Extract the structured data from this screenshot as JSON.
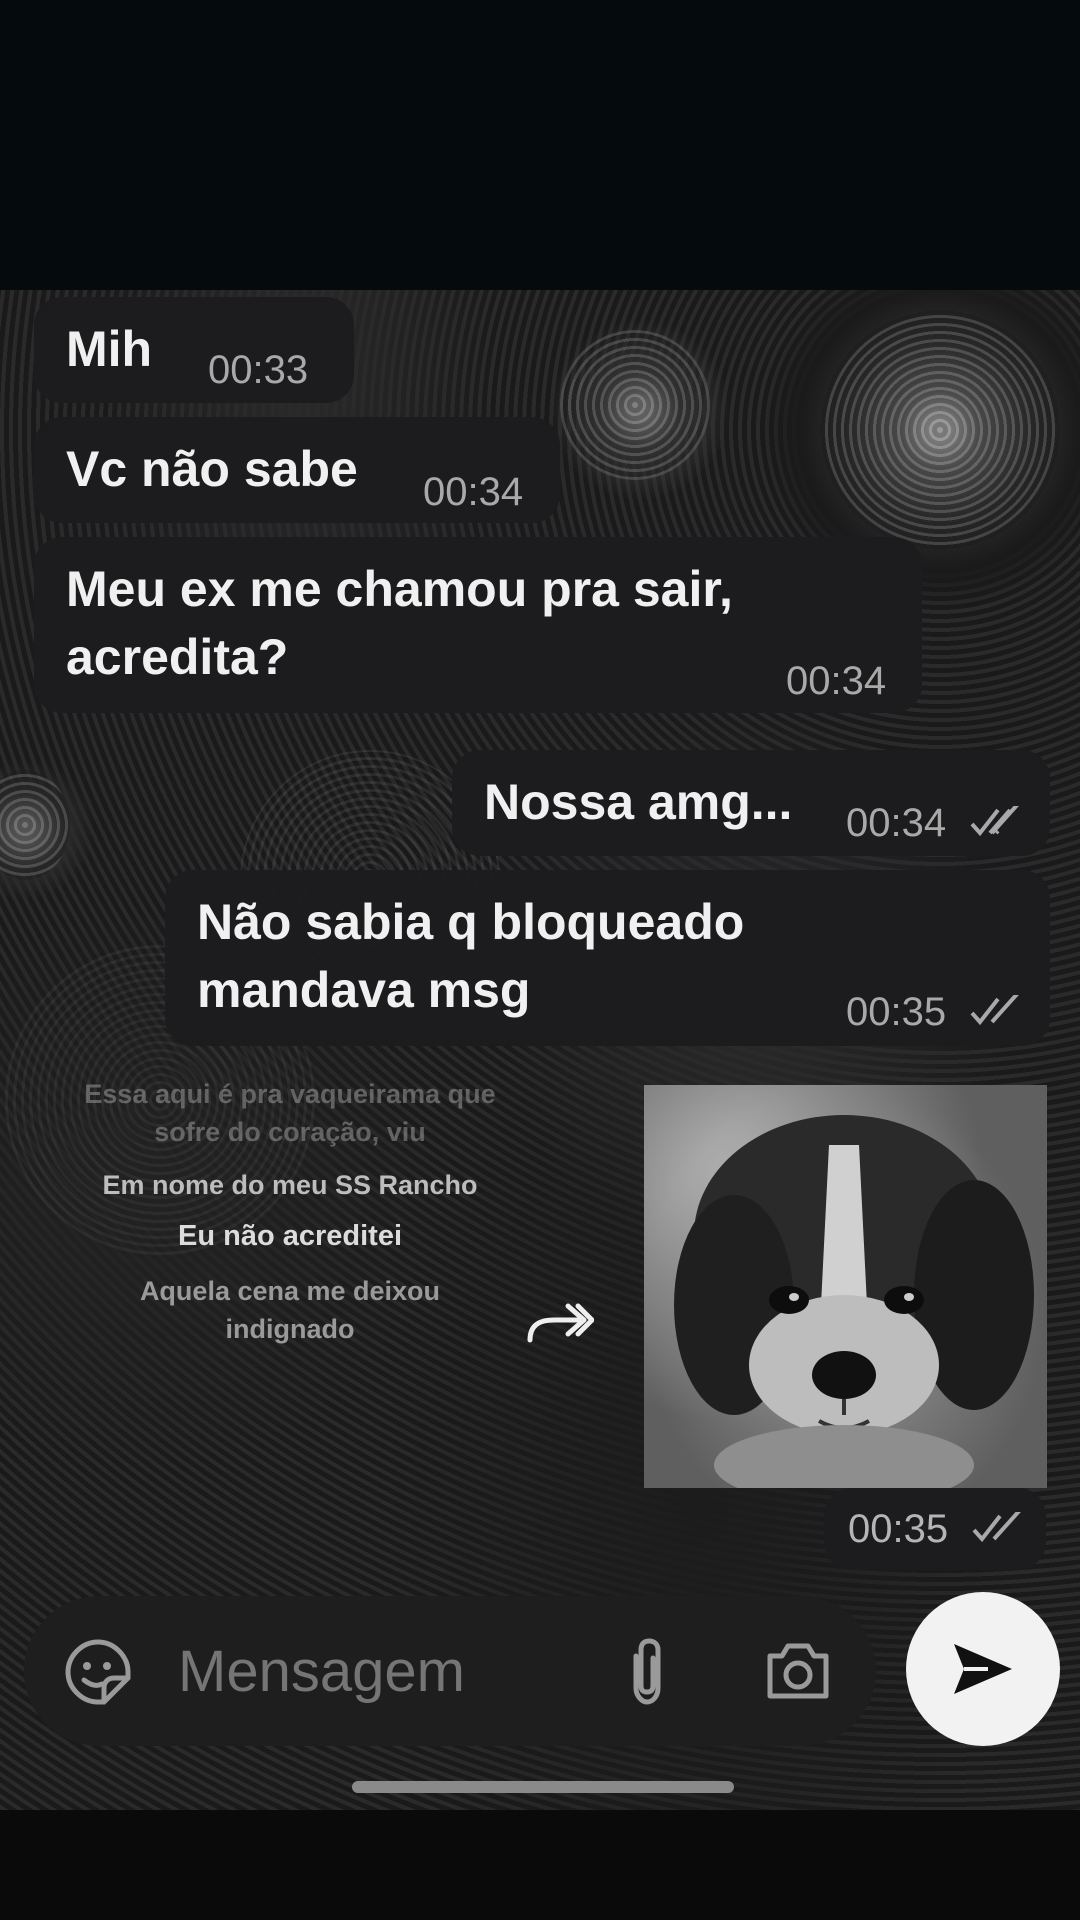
{
  "messages": [
    {
      "text": "Mih",
      "time": "00:33",
      "direction": "incoming"
    },
    {
      "text": "Vc não sabe",
      "time": "00:34",
      "direction": "incoming"
    },
    {
      "text_line1": "Meu ex me chamou pra sair,",
      "text_line2": "acredita?",
      "time": "00:34",
      "direction": "incoming"
    },
    {
      "text": "Nossa amg...",
      "time": "00:34",
      "direction": "outgoing",
      "status": "read"
    },
    {
      "text_line1": "Não sabia q bloqueado",
      "text_line2": "mandava msg",
      "time": "00:35",
      "direction": "outgoing",
      "status": "read"
    },
    {
      "type": "image",
      "time": "00:35",
      "direction": "outgoing",
      "status": "read"
    }
  ],
  "image_message": {
    "lyrics": [
      "Essa aqui é pra vaqueirama que",
      "sofre do coração, viu",
      "Em nome do meu SS Rancho",
      "Eu não acreditei",
      "Aquela cena me deixou",
      "indignado"
    ]
  },
  "composer": {
    "placeholder": "Mensagem"
  },
  "icons": {
    "emoji": "sticker-icon",
    "attach": "paperclip-icon",
    "camera": "camera-icon",
    "send": "send-icon",
    "forward": "forward-icon",
    "read": "double-check-icon"
  },
  "colors": {
    "background": "#141414",
    "bubble": "#1c1c1e",
    "send_button": "#f2f2f2"
  }
}
